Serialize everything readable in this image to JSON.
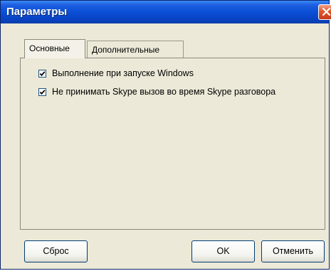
{
  "window": {
    "title": "Параметры"
  },
  "tabs": [
    {
      "label": "Основные",
      "selected": true
    },
    {
      "label": "Дополнительные",
      "selected": false
    }
  ],
  "options": [
    {
      "label": "Выполнение при запуске Windows",
      "checked": true
    },
    {
      "label": "Не принимать Skype вызов во время Skype разговора",
      "checked": true
    }
  ],
  "buttons": {
    "reset": "Сброс",
    "ok": "OK",
    "cancel": "Отменить"
  },
  "colors": {
    "titlebar": "#0a4fd6",
    "close_button": "#e0582c",
    "dialog_face": "#ece9d8",
    "checkbox_border": "#1c5180"
  }
}
